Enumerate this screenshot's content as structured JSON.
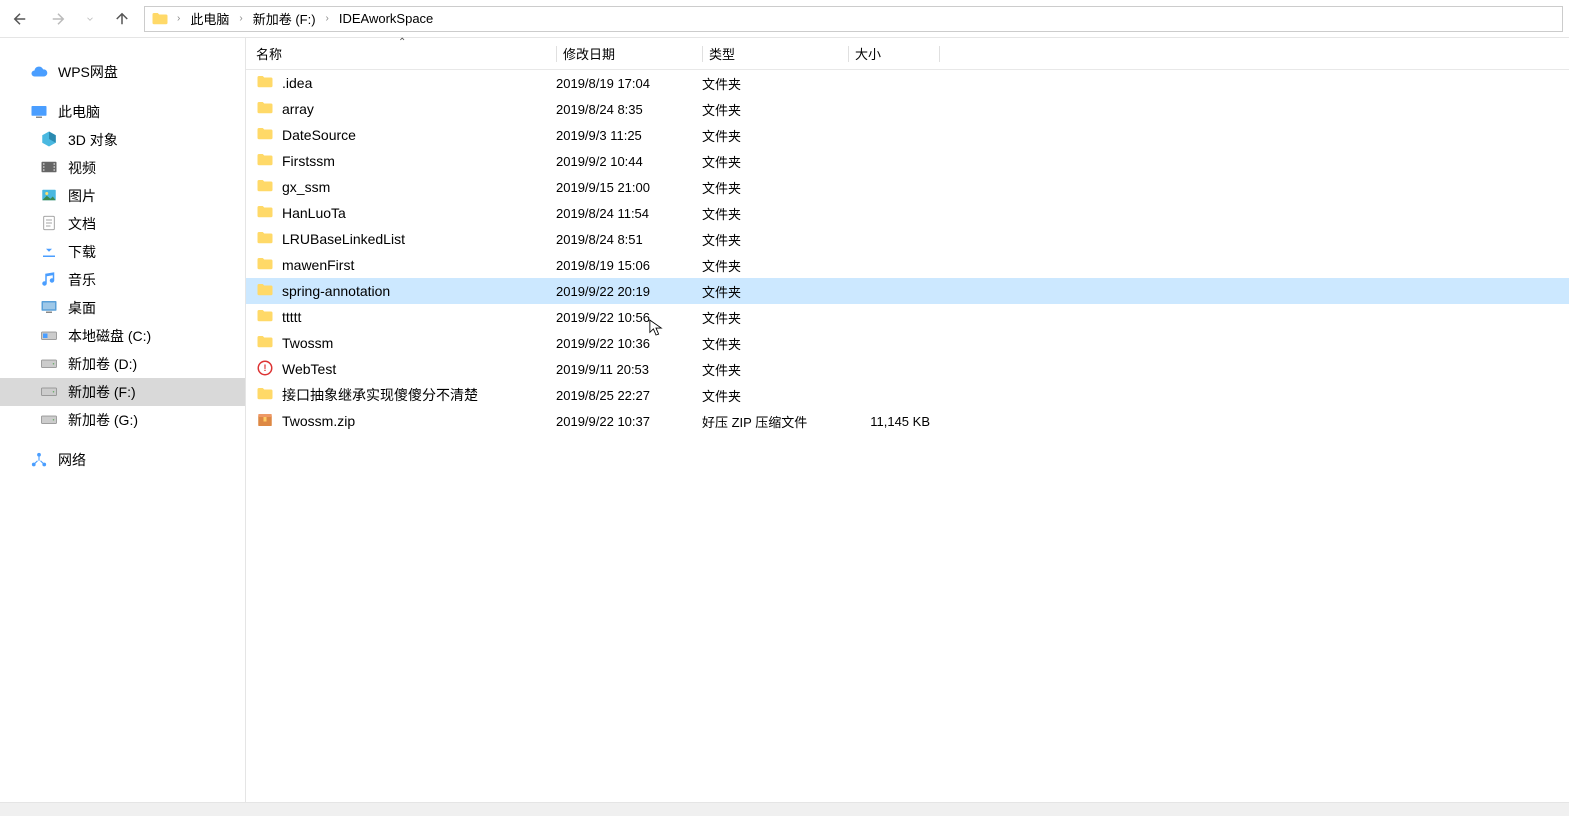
{
  "breadcrumb": {
    "items": [
      "此电脑",
      "新加卷 (F:)",
      "IDEAworkSpace"
    ]
  },
  "sidebar": {
    "wps": "WPS网盘",
    "thispc": "此电脑",
    "items": [
      {
        "label": "3D 对象",
        "icon": "3d"
      },
      {
        "label": "视频",
        "icon": "video"
      },
      {
        "label": "图片",
        "icon": "pictures"
      },
      {
        "label": "文档",
        "icon": "documents"
      },
      {
        "label": "下载",
        "icon": "downloads"
      },
      {
        "label": "音乐",
        "icon": "music"
      },
      {
        "label": "桌面",
        "icon": "desktop"
      },
      {
        "label": "本地磁盘 (C:)",
        "icon": "disk-win"
      },
      {
        "label": "新加卷 (D:)",
        "icon": "disk"
      },
      {
        "label": "新加卷 (F:)",
        "icon": "disk",
        "selected": true
      },
      {
        "label": "新加卷 (G:)",
        "icon": "disk"
      }
    ],
    "network": "网络"
  },
  "columns": {
    "name": "名称",
    "date": "修改日期",
    "type": "类型",
    "size": "大小"
  },
  "files": [
    {
      "name": ".idea",
      "date": "2019/8/19 17:04",
      "type": "文件夹",
      "size": "",
      "icon": "folder"
    },
    {
      "name": "array",
      "date": "2019/8/24 8:35",
      "type": "文件夹",
      "size": "",
      "icon": "folder"
    },
    {
      "name": "DateSource",
      "date": "2019/9/3 11:25",
      "type": "文件夹",
      "size": "",
      "icon": "folder"
    },
    {
      "name": "Firstssm",
      "date": "2019/9/2 10:44",
      "type": "文件夹",
      "size": "",
      "icon": "folder"
    },
    {
      "name": "gx_ssm",
      "date": "2019/9/15 21:00",
      "type": "文件夹",
      "size": "",
      "icon": "folder"
    },
    {
      "name": "HanLuoTa",
      "date": "2019/8/24 11:54",
      "type": "文件夹",
      "size": "",
      "icon": "folder"
    },
    {
      "name": "LRUBaseLinkedList",
      "date": "2019/8/24 8:51",
      "type": "文件夹",
      "size": "",
      "icon": "folder"
    },
    {
      "name": "mawenFirst",
      "date": "2019/8/19 15:06",
      "type": "文件夹",
      "size": "",
      "icon": "folder"
    },
    {
      "name": "spring-annotation",
      "date": "2019/9/22 20:19",
      "type": "文件夹",
      "size": "",
      "icon": "folder",
      "selected": true
    },
    {
      "name": "ttttt",
      "date": "2019/9/22 10:56",
      "type": "文件夹",
      "size": "",
      "icon": "folder"
    },
    {
      "name": "Twossm",
      "date": "2019/9/22 10:36",
      "type": "文件夹",
      "size": "",
      "icon": "folder"
    },
    {
      "name": "WebTest",
      "date": "2019/9/11 20:53",
      "type": "文件夹",
      "size": "",
      "icon": "webtest"
    },
    {
      "name": "接口抽象继承实现傻傻分不清楚",
      "date": "2019/8/25 22:27",
      "type": "文件夹",
      "size": "",
      "icon": "folder"
    },
    {
      "name": "Twossm.zip",
      "date": "2019/9/22 10:37",
      "type": "好压 ZIP 压缩文件",
      "size": "11,145 KB",
      "icon": "zip"
    }
  ]
}
